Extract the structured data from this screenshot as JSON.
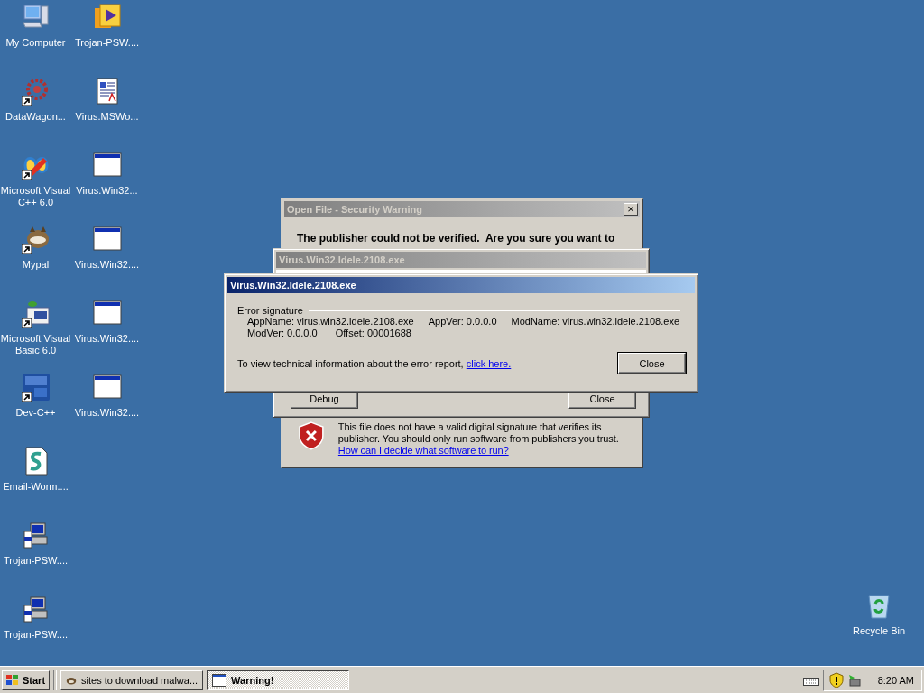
{
  "desktop": {
    "icon_columns": [
      [
        {
          "label": "My Computer",
          "kind": "computer",
          "shortcut": false
        },
        {
          "label": "DataWagon...",
          "kind": "gear",
          "shortcut": true
        },
        {
          "label": "Microsoft Visual C++ 6.0",
          "kind": "vcpp",
          "shortcut": true
        },
        {
          "label": "Mypal",
          "kind": "animal",
          "shortcut": true
        },
        {
          "label": "Microsoft Visual Basic 6.0",
          "kind": "vb",
          "shortcut": true
        },
        {
          "label": "Dev-C++",
          "kind": "dev",
          "shortcut": true
        },
        {
          "label": "Email-Worm....",
          "kind": "script",
          "shortcut": false
        },
        {
          "label": "Trojan-PSW....",
          "kind": "pc",
          "shortcut": false
        },
        {
          "label": "Trojan-PSW....",
          "kind": "pc",
          "shortcut": false
        }
      ],
      [
        {
          "label": "Trojan-PSW....",
          "kind": "media",
          "shortcut": false
        },
        {
          "label": "Virus.MSWo...",
          "kind": "document",
          "shortcut": false
        },
        {
          "label": "Virus.Win32...",
          "kind": "window",
          "shortcut": false
        },
        {
          "label": "Virus.Win32....",
          "kind": "window",
          "shortcut": false
        },
        {
          "label": "Virus.Win32....",
          "kind": "window",
          "shortcut": false
        },
        {
          "label": "Virus.Win32....",
          "kind": "window",
          "shortcut": false
        }
      ]
    ],
    "recycle_bin": {
      "label": "Recycle Bin"
    }
  },
  "windows": [
    {
      "kind": "security_warning",
      "title": "Open File - Security Warning",
      "active": false,
      "close": "×",
      "heading": "The publisher could not be verified.  Are you sure you want to",
      "message": "This file does not have a valid digital signature that verifies its publisher.  You should only run software from publishers you trust.",
      "link": "How can I decide what software to run?"
    },
    {
      "kind": "error_back",
      "title": "Virus.Win32.Idele.2108.exe",
      "active": false,
      "buttons": [
        "Debug",
        "Close"
      ]
    },
    {
      "kind": "error_report",
      "title": "Virus.Win32.Idele.2108.exe",
      "active": true,
      "group_label": "Error signature",
      "signature_rows": [
        [
          "AppName: virus.win32.idele.2108.exe",
          "AppVer: 0.0.0.0",
          "ModName: virus.win32.idele.2108.exe"
        ],
        [
          "ModVer: 0.0.0.0",
          "Offset: 00001688"
        ]
      ],
      "info_text": "To view technical information about the error report, ",
      "info_link": "click here.",
      "button": "Close"
    }
  ],
  "taskbar": {
    "start": "Start",
    "tasks": [
      {
        "label": "sites to download malwa...",
        "selected": false,
        "kind": "browser"
      },
      {
        "label": "Warning!",
        "selected": true,
        "kind": "window"
      }
    ],
    "clock": "8:20 AM"
  }
}
